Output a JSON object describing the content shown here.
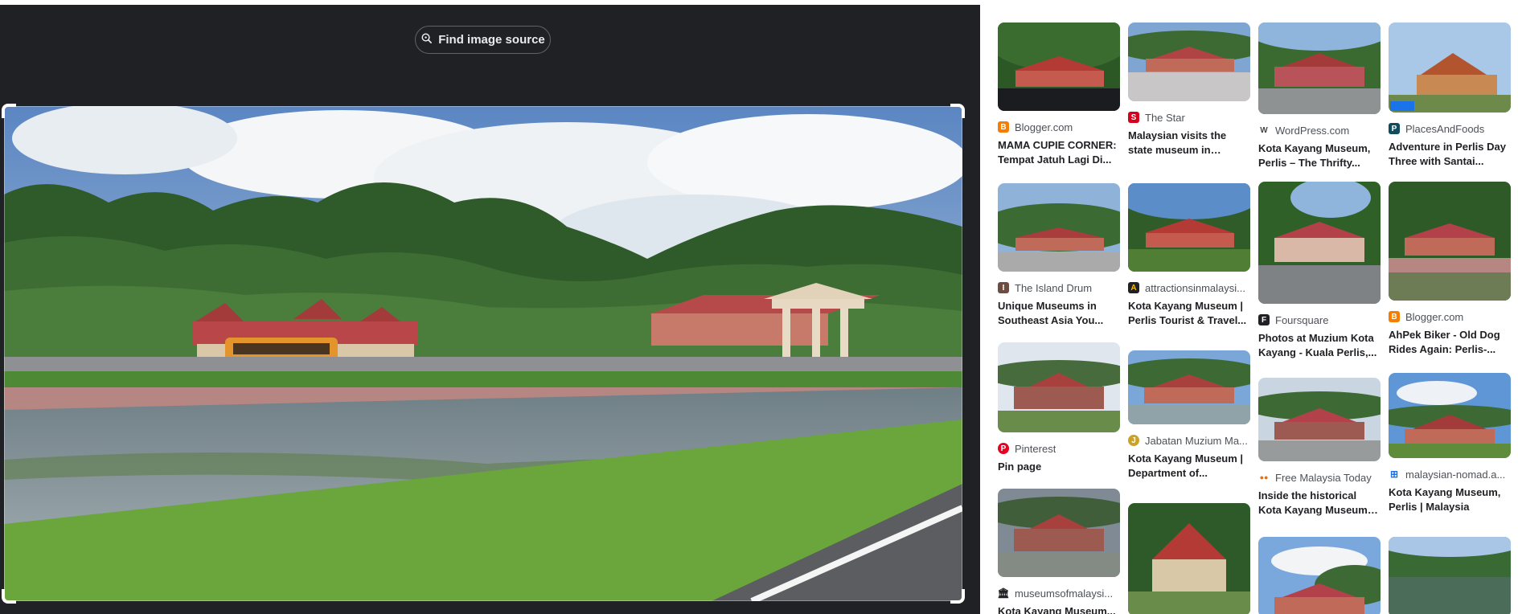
{
  "find_button": {
    "label": "Find image source",
    "icon": "lens-search-icon"
  },
  "colors": {
    "left_bg": "#202124",
    "right_bg": "#ffffff",
    "accent_red": "#b3414a"
  },
  "results": [
    {
      "source": "Blogger.com",
      "favicon": "blogger-icon",
      "title": "MAMA CUPIE CORNER: Tempat Jatuh Lagi Di..."
    },
    {
      "source": "The Star",
      "favicon": "the-star-icon",
      "title": "Malaysian visits the state museum in Perlis..."
    },
    {
      "source": "WordPress.com",
      "favicon": "wordpress-icon",
      "title": "Kota Kayang Museum, Perlis – The Thrifty..."
    },
    {
      "source": "PlacesAndFoods",
      "favicon": "placesandfoods-icon",
      "title": "Adventure in Perlis Day Three with Santai..."
    },
    {
      "source": "The Island Drum",
      "favicon": "island-drum-icon",
      "title": "Unique Museums in Southeast Asia You..."
    },
    {
      "source": "attractionsinmalaysi...",
      "favicon": "attractions-icon",
      "title": "Kota Kayang Museum | Perlis Tourist & Travel..."
    },
    {
      "source": "Foursquare",
      "favicon": "foursquare-icon",
      "title": "Photos at Muzium Kota Kayang - Kuala Perlis,..."
    },
    {
      "source": "Blogger.com",
      "favicon": "blogger-icon",
      "title": "AhPek Biker - Old Dog Rides Again: Perlis-..."
    },
    {
      "source": "Pinterest",
      "favicon": "pinterest-icon",
      "title": "Pin page"
    },
    {
      "source": "Jabatan Muzium Ma...",
      "favicon": "jabatan-muzium-icon",
      "title": "Kota Kayang Museum | Department of..."
    },
    {
      "source": "Free Malaysia Today",
      "favicon": "fmt-icon",
      "title": "Inside the historical Kota Kayang Museum in Perl..."
    },
    {
      "source": "malaysian-nomad.a...",
      "favicon": "malaysian-nomad-icon",
      "title": "Kota Kayang Museum, Perlis | Malaysia"
    },
    {
      "source": "museumsofmalaysi...",
      "favicon": "museum-icon",
      "title": "Kota Kayang Museum..."
    }
  ]
}
